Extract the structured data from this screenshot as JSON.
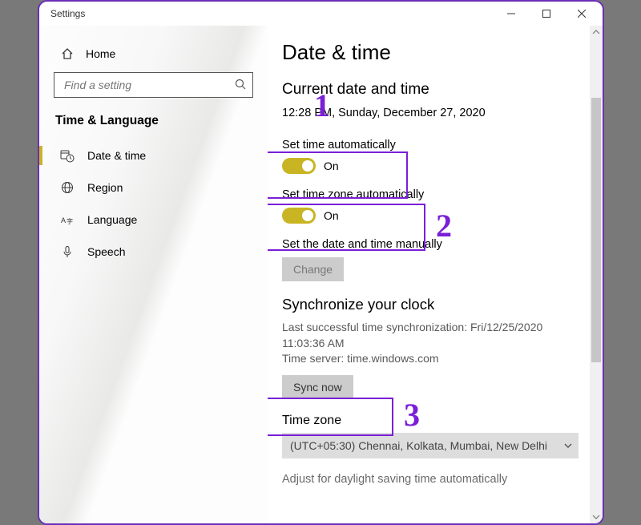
{
  "titlebar": {
    "title": "Settings"
  },
  "sidebar": {
    "home_label": "Home",
    "search_placeholder": "Find a setting",
    "section_title": "Time & Language",
    "items": [
      {
        "label": "Date & time",
        "active": true
      },
      {
        "label": "Region",
        "active": false
      },
      {
        "label": "Language",
        "active": false
      },
      {
        "label": "Speech",
        "active": false
      }
    ]
  },
  "main": {
    "page_title": "Date & time",
    "current_title": "Current date and time",
    "current_value": "12:28 PM, Sunday, December 27, 2020",
    "auto_time": {
      "label": "Set time automatically",
      "state": "On"
    },
    "auto_tz": {
      "label": "Set time zone automatically",
      "state": "On"
    },
    "manual": {
      "label": "Set the date and time manually",
      "button": "Change"
    },
    "sync": {
      "title": "Synchronize your clock",
      "last_sync_line1": "Last successful time synchronization: Fri/12/25/2020",
      "last_sync_line2": "11:03:36 AM",
      "server_line": "Time server: time.windows.com",
      "button": "Sync now"
    },
    "timezone": {
      "title": "Time zone",
      "value": "(UTC+05:30) Chennai, Kolkata, Mumbai, New Delhi"
    },
    "dst_label": "Adjust for daylight saving time automatically"
  },
  "annotations": {
    "n1": "1",
    "n2": "2",
    "n3": "3"
  }
}
